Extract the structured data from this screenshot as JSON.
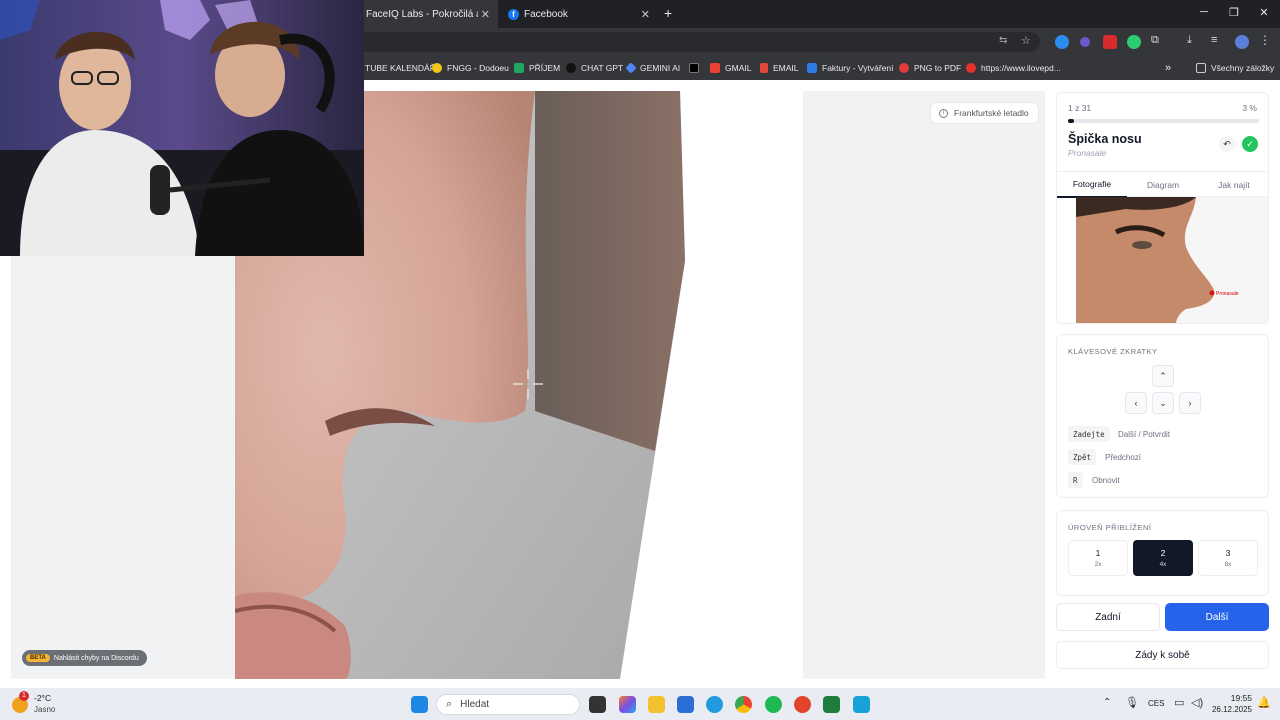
{
  "browser": {
    "tabs": [
      {
        "label": "FaceIQ Labs - Pokročilá analýza",
        "active": true
      },
      {
        "label": "Facebook",
        "active": false
      }
    ],
    "bookmarks": [
      {
        "label": "TUBE KALENDÁŘ",
        "color": "#ff0000"
      },
      {
        "label": "FNGG - Dodoeu",
        "color": "#f5c518"
      },
      {
        "label": "PŘÍJEM",
        "color": "#1fa463"
      },
      {
        "label": "CHAT GPT",
        "color": "#111111"
      },
      {
        "label": "GEMINI AI",
        "color": "#4e86f5"
      },
      {
        "label": "",
        "color": "#000000"
      },
      {
        "label": "GMAIL",
        "color": "#ea4335"
      },
      {
        "label": "EMAIL",
        "color": "#e0483e"
      },
      {
        "label": "Faktury - Vytváření",
        "color": "#2d7be5"
      },
      {
        "label": "PNG to PDF",
        "color": "#e03c3c"
      },
      {
        "label": "https://www.ilovepd...",
        "color": "#e5322d"
      }
    ],
    "all_bookmarks_label": "Všechny záložky"
  },
  "canvas": {
    "plane_badge": "Frankfurtské letadlo",
    "beta_tag": "BETA",
    "beta_text": "Nahlásit chyby na Discordu"
  },
  "panel": {
    "progress_label": "1 z 31",
    "progress_pct_label": "3 %",
    "progress_fraction": 0.03,
    "landmark_title": "Špička nosu",
    "landmark_subtitle": "Pronasale",
    "tabs": [
      "Fotografie",
      "Diagram",
      "Jak najít"
    ],
    "reference_label": "Pronasale",
    "shortcuts_title": "KLÁVESOVÉ ZKRATKY",
    "shortcuts": [
      {
        "key": "Zadejte",
        "desc": "Další / Potvrdit"
      },
      {
        "key": "Zpět",
        "desc": "Předchozí"
      },
      {
        "key": "R",
        "desc": "Obnovit"
      }
    ],
    "zoom_title": "ÚROVEŇ PŘIBLÍŽENÍ",
    "zoom_levels": [
      {
        "num": "1",
        "mult": "2x",
        "active": false
      },
      {
        "num": "2",
        "mult": "4x",
        "active": true
      },
      {
        "num": "3",
        "mult": "8x",
        "active": false
      }
    ],
    "back_label": "Zadní",
    "next_label": "Další",
    "back_to_self_label": "Zády k sobě"
  },
  "taskbar": {
    "weather_temp": "-2°C",
    "weather_desc": "Jasno",
    "search_placeholder": "Hledat",
    "lang": "CES",
    "time": "19:55",
    "date": "26.12.2025"
  },
  "colors": {
    "accent": "#2563eb",
    "success": "#22c55e",
    "dark": "#111827"
  }
}
